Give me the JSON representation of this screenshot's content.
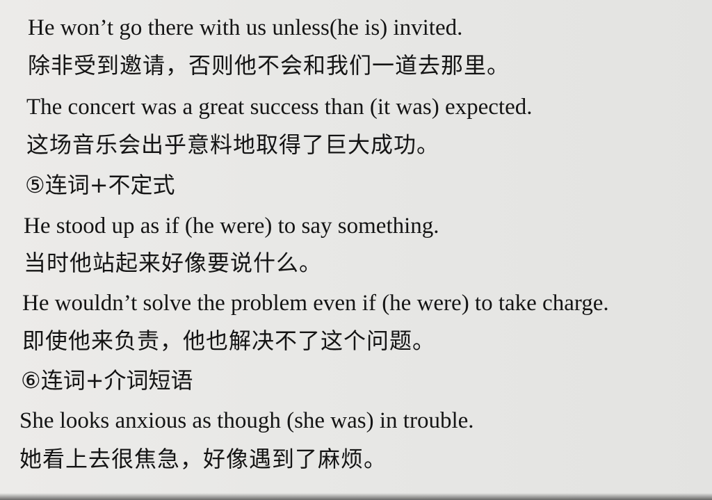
{
  "lines": [
    "He won’t go there with us unless(he is) invited.",
    "除非受到邀请，否则他不会和我们一道去那里。",
    "The concert was a great success than (it was) expected.",
    "这场音乐会出乎意料地取得了巨大成功。",
    "⑤连词+不定式",
    "He stood up as if (he were) to say something.",
    "当时他站起来好像要说什么。",
    "He wouldn’t solve the problem even if (he were) to take charge.",
    "即使他来负责，他也解决不了这个问题。",
    "⑥连词+介词短语",
    "She looks anxious as though (she was) in trouble.",
    "她看上去很焦急，好像遇到了麻烦。"
  ]
}
